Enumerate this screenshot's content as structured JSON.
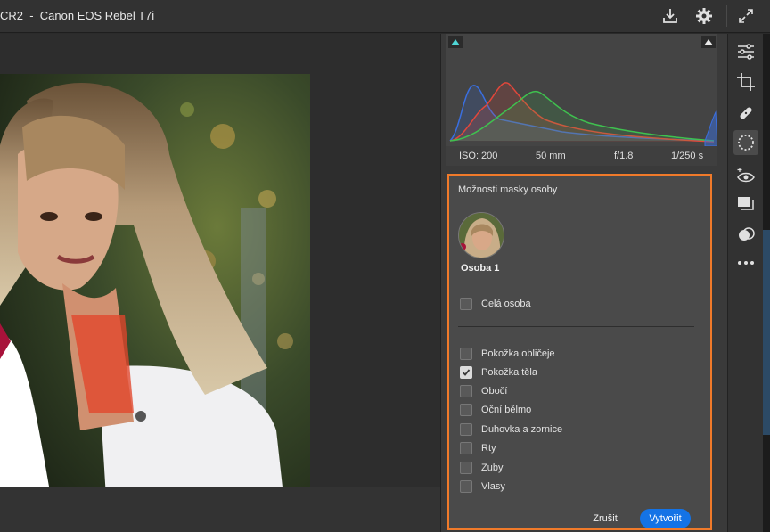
{
  "titlebar": {
    "title": "CR2  -  Canon EOS Rebel T7i"
  },
  "toolbar_top": {
    "icons": [
      "export-icon",
      "settings-gear-icon",
      "fullscreen-icon"
    ]
  },
  "histogram": {
    "exif": {
      "iso": "ISO: 200",
      "focal": "50 mm",
      "aperture": "f/1.8",
      "shutter": "1/250 s"
    },
    "colors": {
      "red": "#e2473b",
      "green": "#3fc14f",
      "blue": "#3a6fe0"
    }
  },
  "mask_panel": {
    "title": "Možnosti masky osoby",
    "person": "Osoba 1",
    "whole_person": {
      "label": "Celá osoba",
      "checked": false
    },
    "options": [
      {
        "label": "Pokožka obličeje",
        "checked": false
      },
      {
        "label": "Pokožka těla",
        "checked": true
      },
      {
        "label": "Obočí",
        "checked": false
      },
      {
        "label": "Oční bělmo",
        "checked": false
      },
      {
        "label": "Duhovka a zornice",
        "checked": false
      },
      {
        "label": "Rty",
        "checked": false
      },
      {
        "label": "Zuby",
        "checked": false
      },
      {
        "label": "Vlasy",
        "checked": false
      }
    ],
    "cancel_label": "Zrušit",
    "create_label": "Vytvořit",
    "accent": "#1473e6",
    "highlight": "#f07a2a"
  },
  "side_tools": [
    "edit-sliders-icon",
    "crop-icon",
    "healing-bandage-icon",
    "masking-icon",
    "red-eye-icon",
    "presets-icon",
    "snapshots-icon",
    "more-icon"
  ]
}
